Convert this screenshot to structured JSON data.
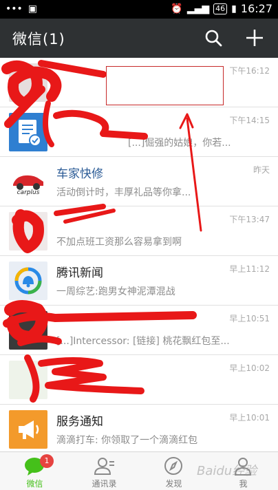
{
  "status_bar": {
    "network": "46",
    "time": "16:27"
  },
  "app_bar": {
    "title": "微信(1)"
  },
  "chats": [
    {
      "name": "",
      "preview": "",
      "time": "下午16:12",
      "avatar": "redacted"
    },
    {
      "name": "",
      "preview": "[...]倔强的姑娘，你若...",
      "time": "下午14:15",
      "avatar": "document-card"
    },
    {
      "name": "车家快修",
      "preview": "活动倒计时，丰厚礼品等你拿...",
      "time": "昨天",
      "avatar": "carplus-logo"
    },
    {
      "name": "",
      "preview": "不加点班工资那么容易拿到啊",
      "time": "下午13:47",
      "avatar": "redacted"
    },
    {
      "name": "腾讯新闻",
      "preview": "一周综艺:跑男女神泥潭混战",
      "time": "早上11:12",
      "avatar": "tencent-news"
    },
    {
      "name": "",
      "preview": "[...]Intercessor: [链接] 桃花飘红包至...",
      "time": "早上10:51",
      "avatar": "redacted"
    },
    {
      "name": "",
      "preview": "",
      "time": "早上10:02",
      "avatar": "redacted"
    },
    {
      "name": "服务通知",
      "preview": "滴滴打车: 你领取了一个滴滴红包",
      "time": "早上10:01",
      "avatar": "service-horn"
    }
  ],
  "tabs": [
    {
      "label": "微信",
      "icon": "chat-bubble-icon",
      "badge": "1",
      "active": true
    },
    {
      "label": "通讯录",
      "icon": "contacts-icon"
    },
    {
      "label": "发现",
      "icon": "compass-icon"
    },
    {
      "label": "我",
      "icon": "person-icon"
    }
  ],
  "colors": {
    "accent": "#45c01a",
    "header": "#2e3133",
    "annotation": "#e81818"
  },
  "overlay": {
    "watermark": "Baidu经验"
  }
}
